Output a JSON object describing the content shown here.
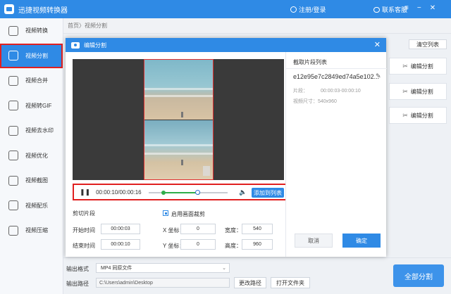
{
  "app": {
    "title": "迅捷视频转换器",
    "login": "注册/登录",
    "contact": "联系客服"
  },
  "sidebar": {
    "items": [
      {
        "label": "视频转换",
        "icon": "video-convert-icon"
      },
      {
        "label": "视频分割",
        "icon": "video-split-icon",
        "active": true
      },
      {
        "label": "视频合并",
        "icon": "video-merge-icon"
      },
      {
        "label": "视频转GIF",
        "icon": "gif-icon"
      },
      {
        "label": "视频去水印",
        "icon": "watermark-icon"
      },
      {
        "label": "视频优化",
        "icon": "optimize-icon"
      },
      {
        "label": "视频截图",
        "icon": "screenshot-icon"
      },
      {
        "label": "视频配乐",
        "icon": "music-icon"
      },
      {
        "label": "视频压缩",
        "icon": "compress-icon"
      }
    ]
  },
  "breadcrumb": "首页〉视频分割",
  "background": {
    "clear_list": "清空列表",
    "edit_split": "编辑分割"
  },
  "bottom": {
    "format_label": "输出格式",
    "format_value": "MP4  同原文件",
    "path_label": "输出路径",
    "path_value": "C:\\Users\\admin\\Desktop",
    "change_path": "更改路径",
    "open_folder": "打开文件夹",
    "split_all": "全部分割"
  },
  "modal": {
    "title": "编辑分割",
    "time_display": "00:00:10/00:00:16",
    "add_to_list": "添加到列表",
    "clip_section": "剪切片段",
    "start_label": "开始时间",
    "start_value": "00:00:03",
    "end_label": "结束时间",
    "end_value": "00:00:10",
    "crop_enable": "启用画面裁剪",
    "x_label": "X 坐标：",
    "x_value": "0",
    "y_label": "Y 坐标：",
    "y_value": "0",
    "width_label": "宽度：",
    "width_value": "540",
    "height_label": "高度：",
    "height_value": "960",
    "playback": {
      "current_fraction": 0.625,
      "start_fraction": 0.1875,
      "end_fraction": 0.625
    },
    "list_title": "截取片段列表",
    "clip_name": "e12e95e7c2849ed74a5e102...",
    "clip_segment_label": "片段：",
    "clip_segment_value": "00:00:03-00:00:10",
    "clip_size": "视频尺寸：540x960",
    "cancel": "取消",
    "ok": "确定"
  },
  "colors": {
    "primary": "#2f8ae5",
    "highlight": "#e02020",
    "progress": "#2fae4a"
  }
}
